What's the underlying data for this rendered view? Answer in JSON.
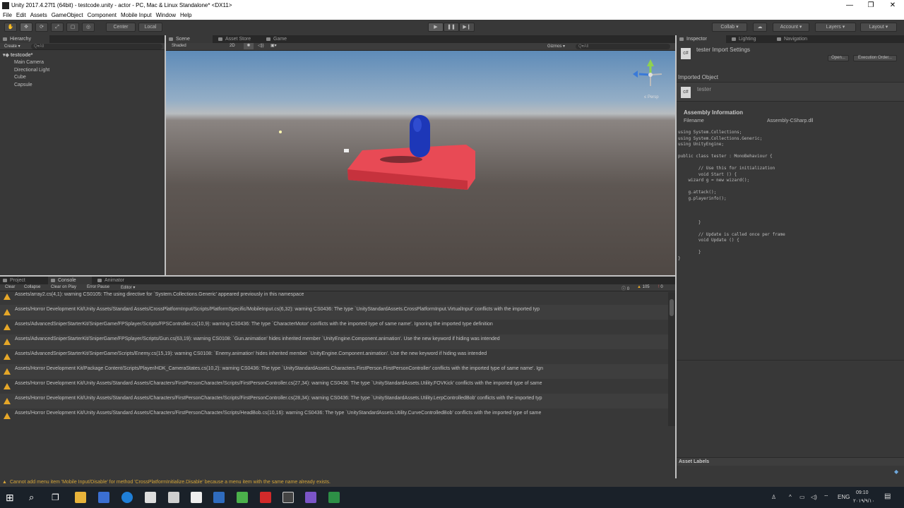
{
  "window": {
    "title": "Unity 2017.4.27f1 (64bit) - testcode.unity - actor - PC, Mac & Linux Standalone* <DX11>",
    "minimize": "—",
    "maximize": "❐",
    "close": "✕"
  },
  "menubar": [
    "File",
    "Edit",
    "Assets",
    "GameObject",
    "Component",
    "Mobile Input",
    "Window",
    "Help"
  ],
  "toolbar": {
    "center": "Center",
    "local": "Local",
    "collab": "Collab ▾",
    "account": "Account ▾",
    "layers": "Layers ▾",
    "layout": "Layout ▾"
  },
  "hierarchy": {
    "tab": "Hierarchy",
    "create": "Create ▾",
    "search_placeholder": "Q▾All",
    "scene": "testcode*",
    "items": [
      "Main Camera",
      "Directional Light",
      "Cube",
      "Capsule"
    ]
  },
  "scene": {
    "tabs": [
      "Scene",
      "Asset Store",
      "Game"
    ],
    "shading": "Shaded",
    "mode_2d": "2D",
    "gizmos": "Gizmos ▾",
    "search": "Q▾All",
    "persp": "≤ Persp"
  },
  "inspector": {
    "tabs": [
      "Inspector",
      "Lighting",
      "Navigation"
    ],
    "header": "tester Import Settings",
    "open_button": "Open...",
    "execution_order_button": "Execution Order...",
    "imported_object_label": "Imported Object",
    "object_name": "tester",
    "assembly_heading": "Assembly Information",
    "filename_label": "Filename",
    "filename_value": "Assembly-CSharp.dll",
    "code": [
      "using System.Collections;",
      "using System.Collections.Generic;",
      "using UnityEngine;",
      "",
      "public class tester : MonoBehaviour {",
      "",
      "        // Use this for initialization",
      "        void Start () {",
      "    wizard g = new wizard();",
      "",
      "    g.attack();",
      "    g.playerinfo();",
      "",
      "",
      "",
      "        }",
      "",
      "        // Update is called once per frame",
      "        void Update () {",
      "",
      "        }",
      "}"
    ],
    "asset_labels": "Asset Labels"
  },
  "console": {
    "tabs": [
      "Project",
      "Console",
      "Animator"
    ],
    "buttons": [
      "Clear",
      "Collapse",
      "Clear on Play",
      "Error Pause",
      "Editor ▾"
    ],
    "counts": {
      "errors": "0",
      "warnings": "105",
      "messages": "0"
    },
    "rows": [
      "Assets/array2.cs(4,1): warning CS0105: The using directive for `System.Collections.Generic' appeared previously in this namespace",
      "Assets/Horror Development Kit/Unity Assets/Standard Assets/CrossPlatformInput/Scripts/PlatformSpecific/MobileInput.cs(6,32): warning CS0436: The type `UnityStandardAssets.CrossPlatformInput.VirtualInput' conflicts with the imported typ",
      "Assets/AdvancedSniperStarterKit/SniperGame/FPSplayer/Scripts/FPSController.cs(10,9): warning CS0436: The type `CharacterMotor' conflicts with the imported type of same name'. Ignoring the imported type definition",
      "Assets/AdvancedSniperStarterKit/SniperGame/FPSplayer/Scripts/Gun.cs(63,19): warning CS0108: `Gun.animation' hides inherited member `UnityEngine.Component.animation'. Use the new keyword if hiding was intended",
      "Assets/AdvancedSniperStarterKit/SniperGame/Scripts/Enemy.cs(15,19): warning CS0108: `Enemy.animation' hides inherited member `UnityEngine.Component.animation'. Use the new keyword if hiding was intended",
      "Assets/Horror Development Kit/Package Content/Scripts/Player/HDK_CameraStates.cs(10,2): warning CS0436: The type `UnityStandardAssets.Characters.FirstPerson.FirstPersonController' conflicts with the imported type of same name'. Ign",
      "Assets/Horror Development Kit/Unity Assets/Standard Assets/Characters/FirstPersonCharacter/Scripts/FirstPersonController.cs(27,34): warning CS0436: The type `UnityStandardAssets.Utility.FOVKick' conflicts with the imported type of same",
      "Assets/Horror Development Kit/Unity Assets/Standard Assets/Characters/FirstPersonCharacter/Scripts/FirstPersonController.cs(28,34): warning CS0436: The type `UnityStandardAssets.Utility.LerpControlledBob' conflicts with the imported typ",
      "Assets/Horror Development Kit/Unity Assets/Standard Assets/Characters/FirstPersonCharacter/Scripts/HeadBob.cs(10,16): warning CS0436: The type `UnityStandardAssets.Utility.CurveControlledBob' conflicts with the imported type of same"
    ]
  },
  "status": "Cannot add menu item 'Mobile Input/Disable' for method 'CrossPlatformInitialize.Disable' because a menu item with the same name already exists.",
  "taskbar": {
    "language": "ENG",
    "time": "09:10",
    "date": "۲۰۱۹/۹/۱۰"
  },
  "colors": {
    "editor_bg": "#383838",
    "warning": "#e6a728",
    "cube": "#e84a55",
    "capsule": "#1d37b8"
  }
}
